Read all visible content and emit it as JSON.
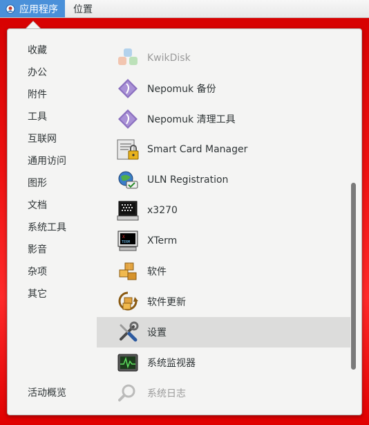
{
  "topbar": {
    "applications_label": "应用程序",
    "places_label": "位置"
  },
  "categories": [
    "收藏",
    "办公",
    "附件",
    "工具",
    "互联网",
    "通用访问",
    "图形",
    "文档",
    "系统工具",
    "影音",
    "杂项",
    "其它"
  ],
  "activities_label": "活动概览",
  "apps": [
    {
      "label": "KwikDisk",
      "icon": "kwikdisk-icon",
      "dim": true
    },
    {
      "label": "Nepomuk 备份",
      "icon": "nepomuk-icon"
    },
    {
      "label": "Nepomuk 清理工具",
      "icon": "nepomuk-icon"
    },
    {
      "label": "Smart Card Manager",
      "icon": "smart-card-icon"
    },
    {
      "label": "ULN Registration",
      "icon": "uln-registration-icon"
    },
    {
      "label": "x3270",
      "icon": "terminal-icon"
    },
    {
      "label": "XTerm",
      "icon": "xterm-icon"
    },
    {
      "label": "软件",
      "icon": "software-icon"
    },
    {
      "label": "软件更新",
      "icon": "software-update-icon"
    },
    {
      "label": "设置",
      "icon": "settings-tools-icon",
      "hover": true
    },
    {
      "label": "系统监视器",
      "icon": "system-monitor-icon"
    },
    {
      "label": "系统日志",
      "icon": "log-search-icon",
      "dim": true
    }
  ],
  "colors": {
    "desktop": "#ee1111",
    "active_menu": "#4a90d9",
    "hover_row": "#dcdcdb"
  }
}
